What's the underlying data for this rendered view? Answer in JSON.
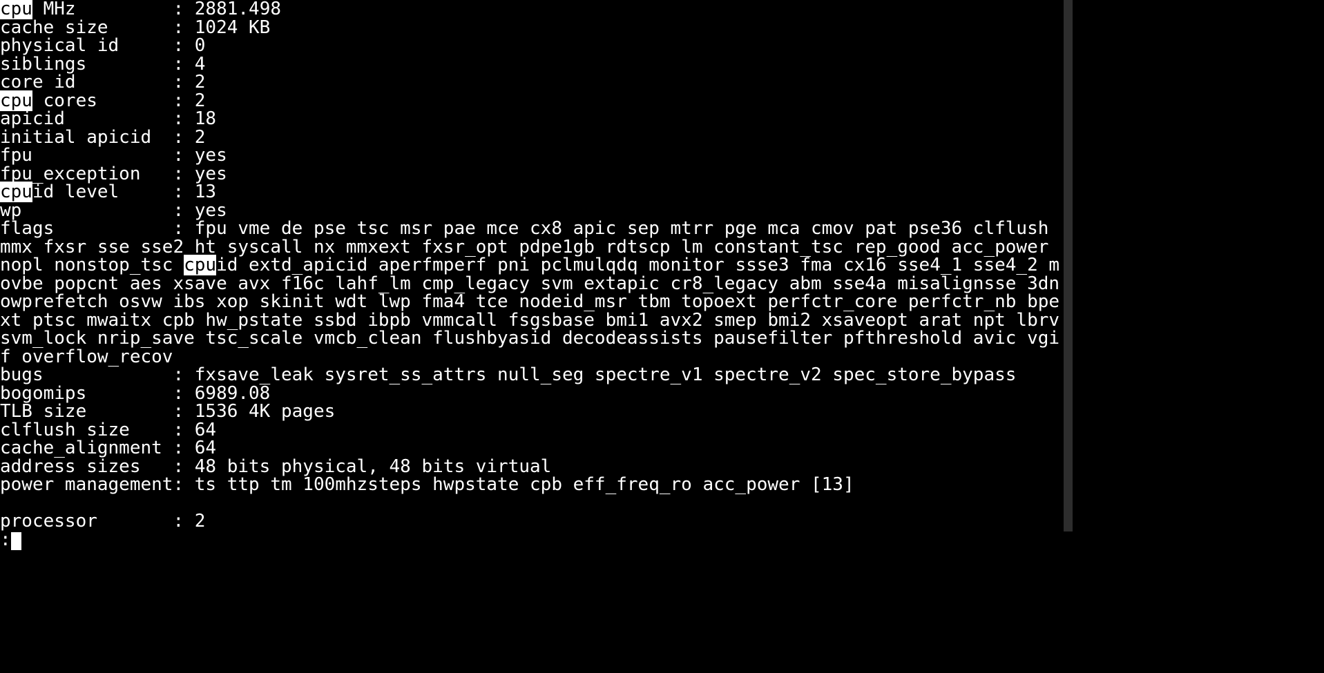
{
  "highlight_term": "cpu",
  "fields": {
    "cpu_mhz_label_prefix_hl": "cpu",
    "cpu_mhz_label_suffix": " MHz",
    "cpu_mhz_value": "2881.498",
    "cache_size_label": "cache size",
    "cache_size_value": "1024 KB",
    "physical_id_label": "physical id",
    "physical_id_value": "0",
    "siblings_label": "siblings",
    "siblings_value": "4",
    "core_id_label": "core id",
    "core_id_value": "2",
    "cpu_cores_label_prefix_hl": "cpu",
    "cpu_cores_label_suffix": " cores",
    "cpu_cores_value": "2",
    "apicid_label": "apicid",
    "apicid_value": "18",
    "initial_apicid_label": "initial apicid",
    "initial_apicid_value": "2",
    "fpu_label": "fpu",
    "fpu_value": "yes",
    "fpu_exception_label": "fpu_exception",
    "fpu_exception_value": "yes",
    "cpuid_level_label_prefix_hl": "cpu",
    "cpuid_level_label_suffix": "id level",
    "cpuid_level_value": "13",
    "wp_label": "wp",
    "wp_value": "yes",
    "flags_label": "flags",
    "flags_value_pre1": "fpu vme de pse tsc msr pae mce cx8 apic sep mtrr pge mca cmov pat pse36 clflush mmx fxsr sse sse2 ht syscall nx mmxext fxsr_opt pdpe1gb rdtscp lm constant_tsc rep_good acc_power nopl nonstop_tsc ",
    "flags_value_hl": "cpu",
    "flags_value_post1": "id extd_apicid aperfmperf pni pclmulqdq monitor ssse3 fma cx16 sse4_1 sse4_2 movbe popcnt aes xsave avx f16c lahf_lm cmp_legacy svm extapic cr8_legacy abm sse4a misalignsse 3dnowprefetch osvw ibs xop skinit wdt lwp fma4 tce nodeid_msr tbm topoext perfctr_core perfctr_nb bpext ptsc mwaitx cpb hw_pstate ssbd ibpb vmmcall fsgsbase bmi1 avx2 smep bmi2 xsaveopt arat npt lbrv svm_lock nrip_save tsc_scale vmcb_clean flushbyasid decodeassists pausefilter pfthreshold avic vgif overflow_recov",
    "bugs_label": "bugs",
    "bugs_value": "fxsave_leak sysret_ss_attrs null_seg spectre_v1 spectre_v2 spec_store_bypass",
    "bogomips_label": "bogomips",
    "bogomips_value": "6989.08",
    "tlb_size_label": "TLB size",
    "tlb_size_value": "1536 4K pages",
    "clflush_size_label": "clflush size",
    "clflush_size_value": "64",
    "cache_alignment_label": "cache_alignment",
    "cache_alignment_value": "64",
    "address_sizes_label": "address sizes",
    "address_sizes_value": "48 bits physical, 48 bits virtual",
    "power_management_label": "power management",
    "power_management_value": "ts ttp tm 100mhzsteps hwpstate cpb eff_freq_ro acc_power [13]",
    "processor_label": "processor",
    "processor_value": "2"
  },
  "pager_prompt": ":",
  "label_column_width": 16,
  "separator": ": "
}
